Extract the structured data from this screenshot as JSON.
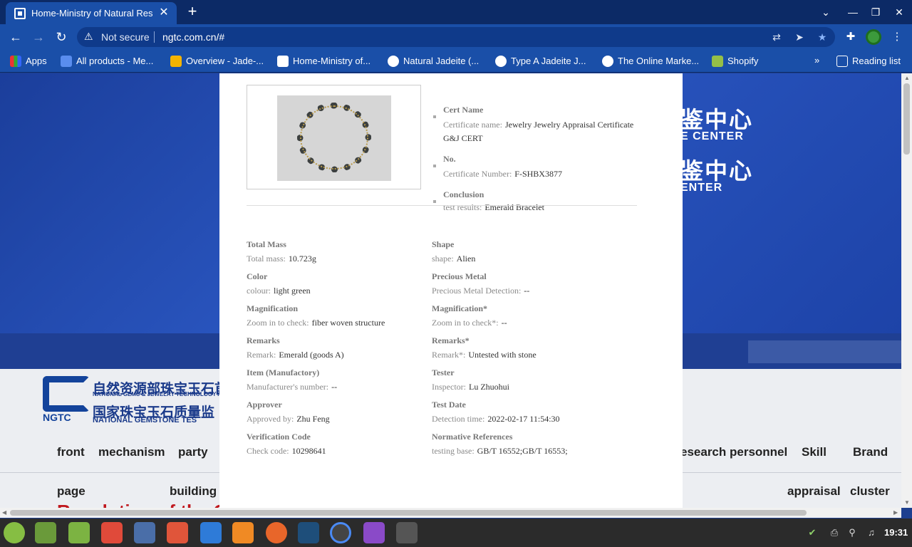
{
  "browser": {
    "tab_title": "Home-Ministry of Natural Res",
    "security_label": "Not secure",
    "url": "ngtc.com.cn/#",
    "bookmarks": [
      {
        "label": "Apps"
      },
      {
        "label": "All products - Me..."
      },
      {
        "label": "Overview - Jade-..."
      },
      {
        "label": "Home-Ministry of..."
      },
      {
        "label": "Natural Jadeite (..."
      },
      {
        "label": "Type A Jadeite J..."
      },
      {
        "label": "The Online Marke..."
      },
      {
        "label": "Shopify"
      }
    ],
    "reading_list": "Reading list",
    "more_bookmarks": "»"
  },
  "site": {
    "banner_lines": [
      "鉴中心",
      "E CENTER",
      "鉴中心",
      "ENTER"
    ],
    "logo_text": "NGTC",
    "org_cn_1": "自然资源部珠宝玉石首",
    "org_en_1": "NATIONAL GEMS & JEWELRY TECHNOLOGY A",
    "org_cn_2": "国家珠宝玉石质量监",
    "org_en_2": "NATIONAL GEMSTONE TES",
    "nav_left": [
      "front",
      "mechanism",
      "party"
    ],
    "nav_right": [
      "esearch personnel",
      "Skill",
      "Brand"
    ],
    "subnav_left": [
      "page",
      "building"
    ],
    "subnav_right": [
      "appraisal",
      "cluster"
    ],
    "red_text": "Resolution of the C                                                                   o  e     i   a   hi   ex  e  t"
  },
  "certificate": {
    "cert_name": {
      "heading": "Cert Name",
      "label": "Certificate name:",
      "value": "Jewelry Jewelry Appraisal Certificate G&J CERT"
    },
    "number": {
      "heading": "No.",
      "label": "Certificate Number:",
      "value": "F-SHBX3877"
    },
    "conclusion": {
      "heading": "Conclusion",
      "label": "test results:",
      "value": "Emerald Bracelet"
    },
    "fields": [
      {
        "heading": "Total Mass",
        "label": "Total mass:",
        "value": "10.723g"
      },
      {
        "heading": "Shape",
        "label": "shape:",
        "value": "Alien"
      },
      {
        "heading": "Color",
        "label": "colour:",
        "value": "light green"
      },
      {
        "heading": "Precious Metal",
        "label": "Precious Metal Detection:",
        "value": "--"
      },
      {
        "heading": "Magnification",
        "label": "Zoom in to check:",
        "value": "fiber woven structure"
      },
      {
        "heading": "Magnification*",
        "label": "Zoom in to check*:",
        "value": "--"
      },
      {
        "heading": "Remarks",
        "label": "Remark:",
        "value": "Emerald (goods A)"
      },
      {
        "heading": "Remarks*",
        "label": "Remark*:",
        "value": "Untested with stone"
      },
      {
        "heading": "Item (Manufactory)",
        "label": "Manufacturer's number:",
        "value": "--"
      },
      {
        "heading": "Tester",
        "label": "Inspector:",
        "value": "Lu Zhuohui"
      },
      {
        "heading": "Approver",
        "label": "Approved by:",
        "value": "Zhu Feng"
      },
      {
        "heading": "Test Date",
        "label": "Detection time:",
        "value": "2022-02-17 11:54:30"
      },
      {
        "heading": "Verification Code",
        "label": "Check code:",
        "value": "10298641"
      },
      {
        "heading": "Normative References",
        "label": "testing base:",
        "value": "GB/T 16552;GB/T 16553;"
      }
    ]
  },
  "taskbar": {
    "clock": "19:31"
  },
  "colors": {
    "chrome_dark": "#0c2a66",
    "chrome": "#1a4fa8",
    "banner": "#2a56c0",
    "red_headline": "#c0181e"
  }
}
